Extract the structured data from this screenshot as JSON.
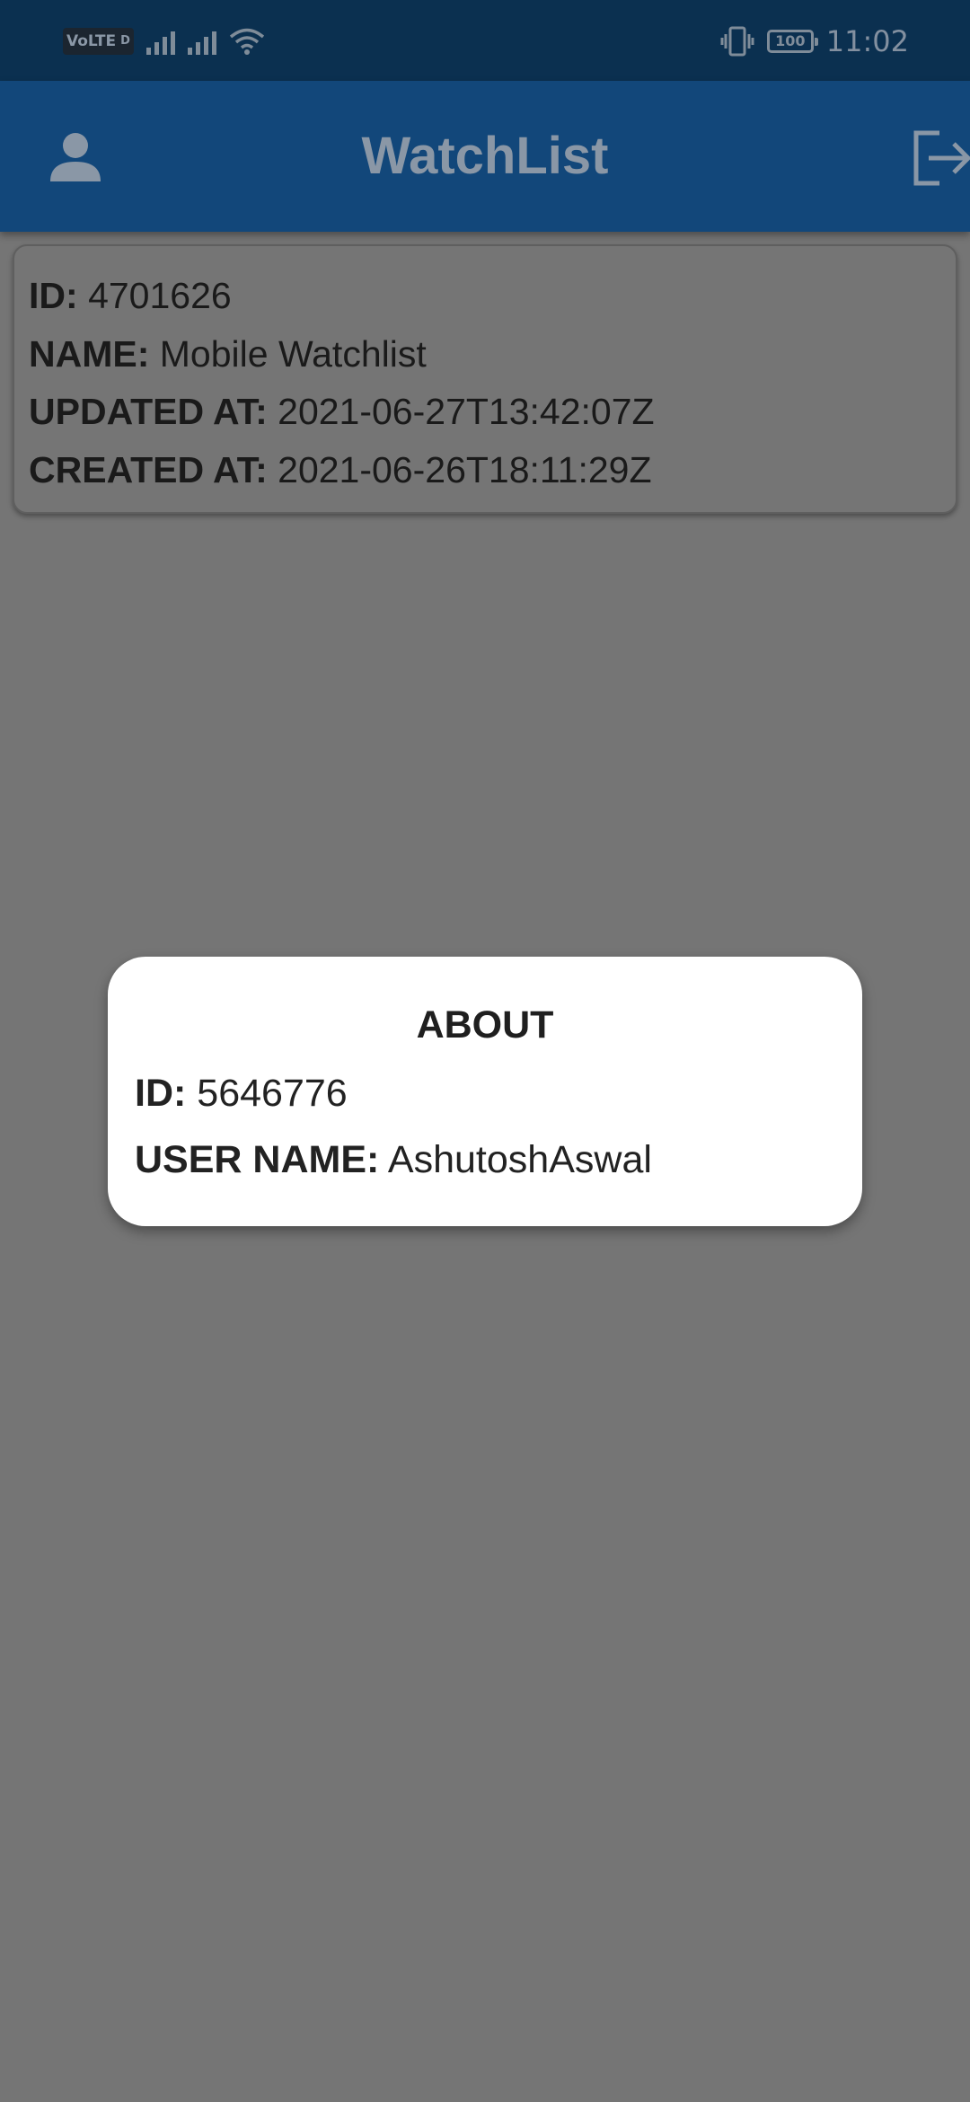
{
  "status_bar": {
    "volte": "VoLTE",
    "volte_sub": "D",
    "battery": "100",
    "time": "11:02",
    "icons": [
      "volte-icon",
      "signal-icon",
      "signal-icon",
      "wifi-icon",
      "vibrate-icon",
      "battery-icon"
    ]
  },
  "app_bar": {
    "title": "WatchList",
    "left_icon": "person-icon",
    "right_icon": "logout-icon"
  },
  "watchlist": {
    "id_label": "ID:",
    "id_value": "4701626",
    "name_label": "NAME:",
    "name_value": "Mobile Watchlist",
    "updated_label": "UPDATED AT:",
    "updated_value": "2021-06-27T13:42:07Z",
    "created_label": "CREATED AT:",
    "created_value": "2021-06-26T18:11:29Z"
  },
  "about_dialog": {
    "title": "ABOUT",
    "id_label": "ID:",
    "id_value": "5646776",
    "username_label": "USER NAME:",
    "username_value": "AshutoshAswal"
  },
  "colors": {
    "status_bar": "#0b3050",
    "app_bar": "#12477a",
    "scrim_background": "#757575",
    "dialog_background": "#ffffff"
  }
}
